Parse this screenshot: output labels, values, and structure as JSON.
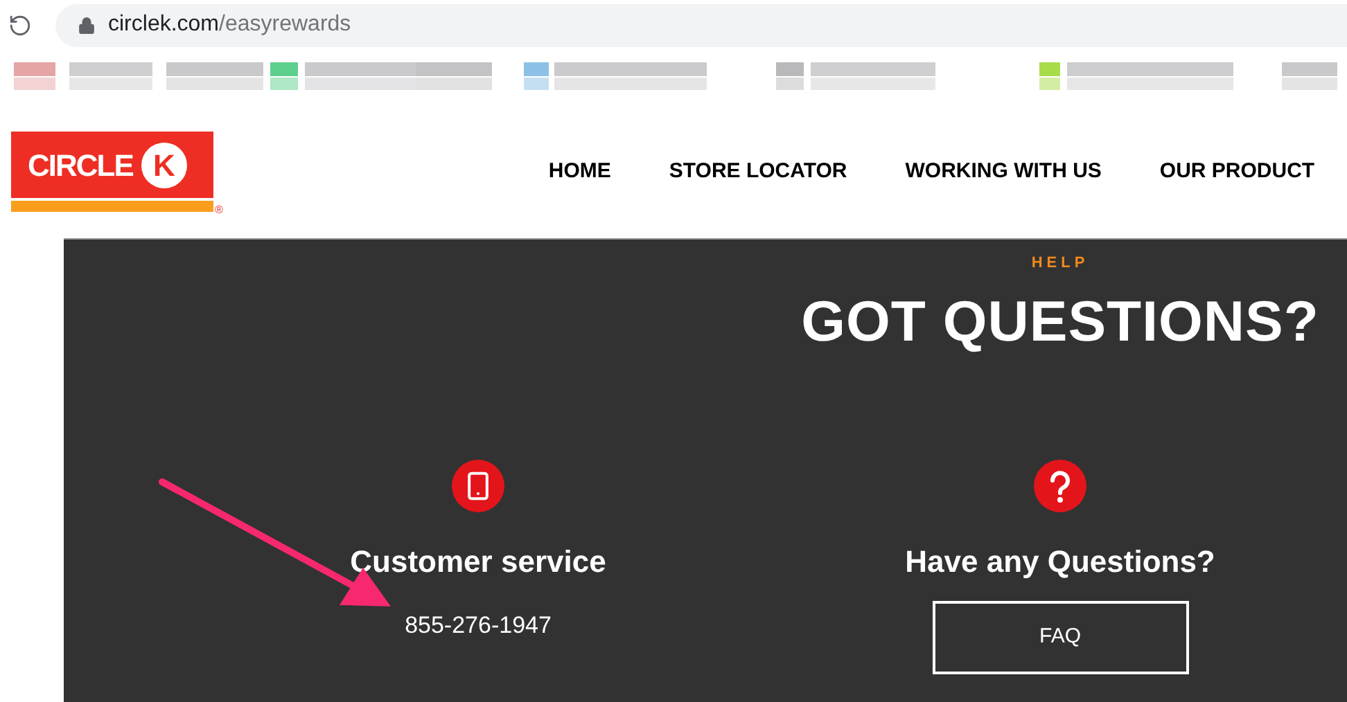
{
  "browser": {
    "url_host": "circlek.com",
    "url_path": "/easyrewards"
  },
  "logo": {
    "word": "CIRCLE",
    "letter": "K",
    "mark": "®"
  },
  "nav": [
    {
      "label": "HOME"
    },
    {
      "label": "STORE LOCATOR"
    },
    {
      "label": "WORKING WITH US"
    },
    {
      "label": "OUR PRODUCT"
    }
  ],
  "help": {
    "eyebrow": "HELP",
    "title": "GOT QUESTIONS?"
  },
  "cards": [
    {
      "kind": "phone",
      "heading": "Customer service",
      "text": "855-276-1947"
    },
    {
      "kind": "question",
      "heading": "Have any Questions?",
      "button": "FAQ"
    }
  ]
}
